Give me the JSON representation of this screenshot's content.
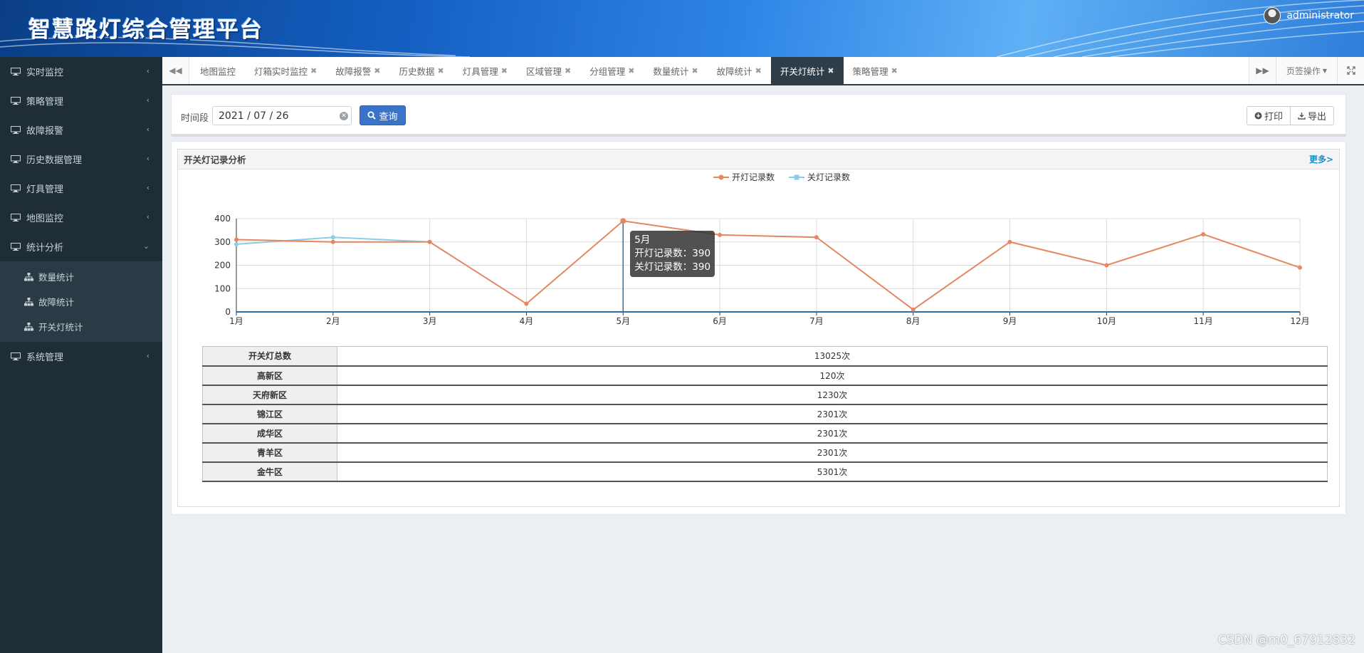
{
  "app": {
    "title": "智慧路灯综合管理平台",
    "user": "administrator"
  },
  "sidebar": {
    "items": [
      {
        "label": "实时监控"
      },
      {
        "label": "策略管理"
      },
      {
        "label": "故障报警"
      },
      {
        "label": "历史数据管理"
      },
      {
        "label": "灯具管理"
      },
      {
        "label": "地图监控"
      },
      {
        "label": "统计分析"
      }
    ],
    "sub_items": [
      {
        "label": "数量统计"
      },
      {
        "label": "故障统计"
      },
      {
        "label": "开关灯统计"
      }
    ],
    "last_item": {
      "label": "系统管理"
    }
  },
  "tabs": [
    {
      "label": "地图监控",
      "closable": false
    },
    {
      "label": "灯箱实时监控",
      "closable": true
    },
    {
      "label": "故障报警",
      "closable": true
    },
    {
      "label": "历史数据",
      "closable": true
    },
    {
      "label": "灯具管理",
      "closable": true
    },
    {
      "label": "区域管理",
      "closable": true
    },
    {
      "label": "分组管理",
      "closable": true
    },
    {
      "label": "数量统计",
      "closable": true
    },
    {
      "label": "故障统计",
      "closable": true
    },
    {
      "label": "开关灯统计",
      "closable": true,
      "active": true
    },
    {
      "label": "策略管理",
      "closable": true
    }
  ],
  "tab_actions": {
    "label": "页签操作"
  },
  "query": {
    "period_label": "时间段",
    "date_value": "2021 / 07 / 26",
    "query_label": "查询",
    "print_label": "打印",
    "export_label": "导出"
  },
  "panel": {
    "title": "开关灯记录分析",
    "more": "更多>"
  },
  "chart_data": {
    "type": "line",
    "x": [
      "1月",
      "2月",
      "3月",
      "4月",
      "5月",
      "6月",
      "7月",
      "8月",
      "9月",
      "10月",
      "11月",
      "12月"
    ],
    "ylim": [
      0,
      400
    ],
    "yticks": [
      0,
      100,
      200,
      300,
      400
    ],
    "grid": true,
    "legend": "top-center",
    "series": [
      {
        "name": "开灯记录数",
        "color": "#e5875f",
        "values": [
          310,
          300,
          300,
          35,
          390,
          330,
          320,
          10,
          300,
          200,
          333,
          190
        ]
      },
      {
        "name": "关灯记录数",
        "color": "#8ecbea",
        "values": [
          290,
          320,
          300,
          null,
          null,
          null,
          null,
          null,
          null,
          null,
          null,
          null
        ]
      }
    ],
    "tooltip": {
      "title": "5月",
      "lines": [
        "开灯记录数：390",
        "关灯记录数：390"
      ]
    }
  },
  "stats_table": [
    {
      "k": "开关灯总数",
      "v": "13025次"
    },
    {
      "k": "高新区",
      "v": "120次"
    },
    {
      "k": "天府新区",
      "v": "1230次"
    },
    {
      "k": "锦江区",
      "v": "2301次"
    },
    {
      "k": "成华区",
      "v": "2301次"
    },
    {
      "k": "青羊区",
      "v": "2301次"
    },
    {
      "k": "金牛区",
      "v": "5301次"
    }
  ],
  "watermark": "CSDN @m0_67912832"
}
